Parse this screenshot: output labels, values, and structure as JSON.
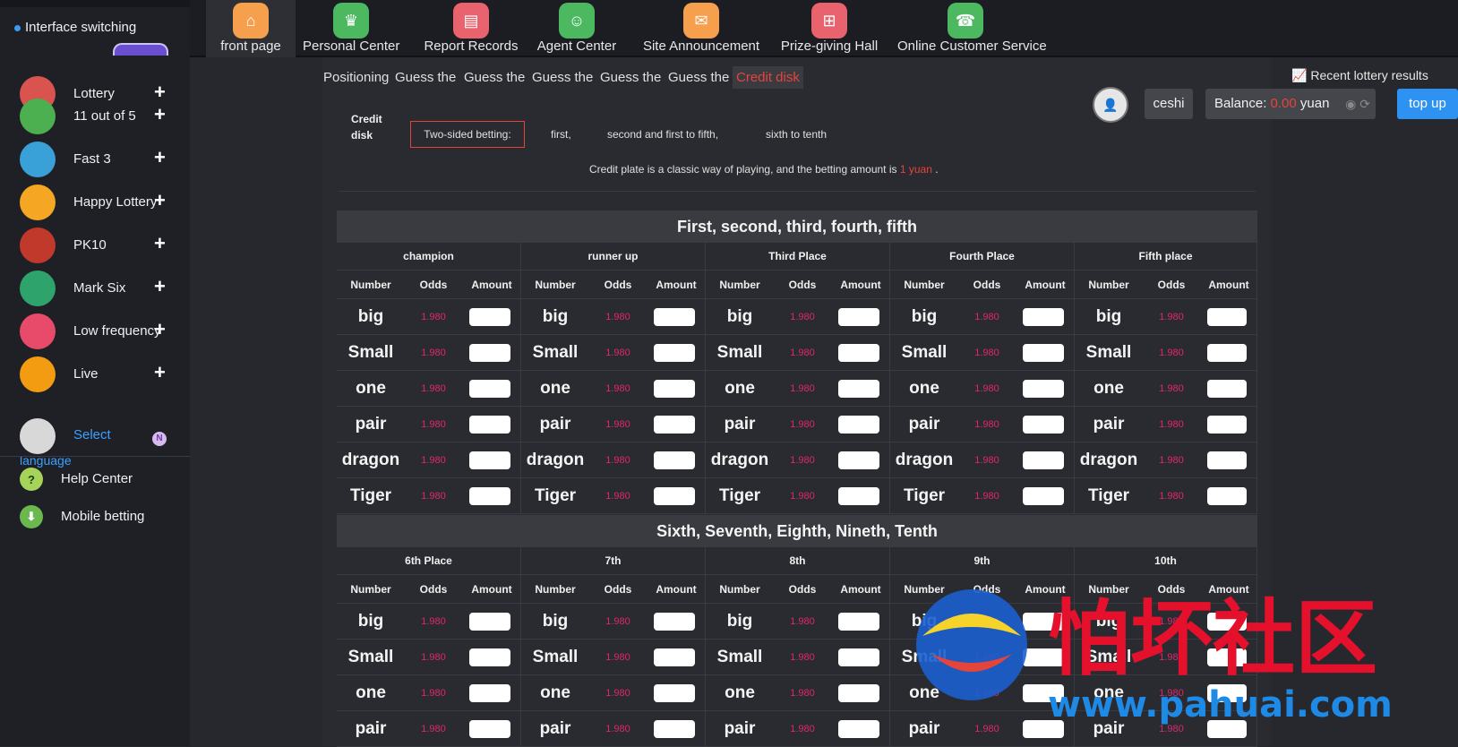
{
  "sidebar": {
    "interface_switching": "Interface switching",
    "lotteries": [
      {
        "label": "Lottery",
        "icon": "lottery-icon",
        "color": "#d9534f"
      },
      {
        "label": "11 out of 5",
        "icon": "eleven-five-icon",
        "color": "#4caf50"
      },
      {
        "label": "Fast 3",
        "icon": "fast3-icon",
        "color": "#3aa0d8"
      },
      {
        "label": "Happy Lottery",
        "icon": "happy-lottery-icon",
        "color": "#f5a623"
      },
      {
        "label": "PK10",
        "icon": "pk10-icon",
        "color": "#c0392b"
      },
      {
        "label": "Mark Six",
        "icon": "mark-six-icon",
        "color": "#2ea36b"
      },
      {
        "label": "Low frequency",
        "icon": "low-frequency-icon",
        "color": "#e84b6a"
      },
      {
        "label": "Live",
        "icon": "live-icon",
        "color": "#f39c12"
      }
    ],
    "select_language_1": "Select",
    "select_language_2": "language",
    "badge": "N",
    "help_center": "Help Center",
    "mobile_betting": "Mobile betting"
  },
  "topnav": [
    {
      "label": "front page",
      "icon": "home-icon",
      "color": "#f6a04d"
    },
    {
      "label": "Personal Center",
      "icon": "crown-icon",
      "color": "#4cb860"
    },
    {
      "label": "Report Records",
      "icon": "report-icon",
      "color": "#e8636e"
    },
    {
      "label": "Agent Center",
      "icon": "agent-icon",
      "color": "#4cb860"
    },
    {
      "label": "Site Announcement",
      "icon": "mail-icon",
      "color": "#f6a04d"
    },
    {
      "label": "Prize-giving Hall",
      "icon": "prize-icon",
      "color": "#e8636e"
    },
    {
      "label": "Online Customer Service",
      "icon": "service-icon",
      "color": "#4cb860"
    }
  ],
  "game_tabs": [
    "Positioning",
    "Guess the",
    "Guess the",
    "Guess the",
    "Guess the",
    "Guess the",
    "Credit disk"
  ],
  "recent_results": "Recent lottery results",
  "user": {
    "name": "ceshi",
    "balance_label": "Balance:",
    "balance": "0.00",
    "currency": "yuan",
    "topup": "top up"
  },
  "credit": {
    "title": "Credit disk",
    "modes": [
      "Two-sided betting:",
      "first,",
      "second and first to fifth,",
      "sixth to tenth"
    ],
    "desc_prefix": "Credit plate is a classic way of playing, and the betting amount is",
    "desc_amount": "1 yuan",
    "desc_suffix": "."
  },
  "sections": [
    {
      "title": "First, second, third, fourth, fifth",
      "columns": [
        "champion",
        "runner up",
        "Third Place",
        "Fourth Place",
        "Fifth place"
      ]
    },
    {
      "title": "Sixth, Seventh, Eighth, Nineth, Tenth",
      "columns": [
        "6th Place",
        "7th",
        "8th",
        "9th",
        "10th"
      ]
    }
  ],
  "table_headers": {
    "number": "Number",
    "odds": "Odds",
    "amount": "Amount"
  },
  "bets": [
    "big",
    "Small",
    "one",
    "pair",
    "dragon",
    "Tiger"
  ],
  "odds_value": "1.980",
  "watermark": {
    "text": "怕坏社区",
    "url": "www.pahuai.com"
  }
}
